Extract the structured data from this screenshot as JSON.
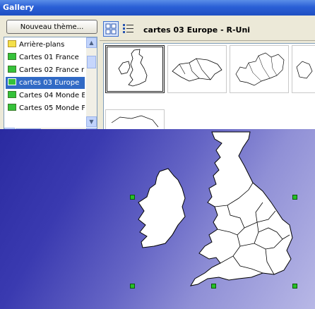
{
  "window": {
    "title": "Gallery"
  },
  "toolbar": {
    "new_theme_label": "Nouveau thème..."
  },
  "themes": [
    {
      "label": "Arrière-plans",
      "icon": "folder-yellow-icon",
      "selected": false
    },
    {
      "label": "Cartes 01 France",
      "icon": "folder-green-icon",
      "selected": false
    },
    {
      "label": "Cartes 02 France r",
      "icon": "folder-green-icon",
      "selected": false
    },
    {
      "label": "cartes 03  Europe",
      "icon": "folder-green-icon",
      "selected": true
    },
    {
      "label": "Cartes 04 Monde E",
      "icon": "folder-green-icon",
      "selected": false
    },
    {
      "label": "Cartes 05 Monde F",
      "icon": "folder-green-icon",
      "selected": false
    }
  ],
  "gallery": {
    "current_theme_title": "cartes 03  Europe - R-Uni"
  },
  "colors": {
    "accent": "#316ac5",
    "titlebar": "#2a5fd6",
    "handle": "#26c026"
  }
}
